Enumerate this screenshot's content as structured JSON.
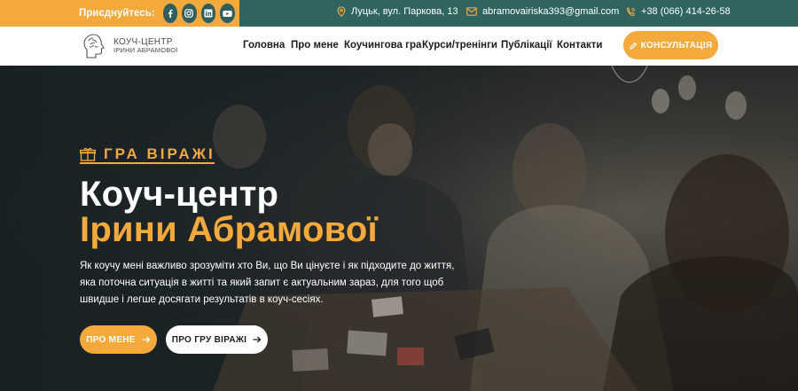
{
  "topbar": {
    "join_label": "Приєднуйтесь:",
    "socials": [
      {
        "icon": "facebook-icon"
      },
      {
        "icon": "instagram-icon"
      },
      {
        "icon": "linkedin-icon"
      },
      {
        "icon": "youtube-icon"
      }
    ],
    "address": "Луцьк, вул. Паркова, 13",
    "email": "abramovairiska393@gmail.com",
    "phone": "+38 (066) 414-26-58"
  },
  "header": {
    "logo_line1": "КОУЧ-ЦЕНТР",
    "logo_line2": "ІРИНИ АБРАМОВОЇ",
    "nav": [
      "Головна",
      "Про мене",
      "Коучингова гра",
      "Курси/тренінги",
      "Публікації",
      "Контакти"
    ],
    "cta_label": "КОНСУЛЬТАЦІЯ"
  },
  "hero": {
    "tag": "ГРА ВІРАЖІ",
    "title_line1": "Коуч-центр",
    "title_line2": "Ірини Абрамової",
    "description": "Як коучу мені важливо зрозуміти хто Ви, що Ви цінуєте і як підходите до життя, яка поточна ситуація в житті та який запит є актуальним зараз, для того щоб швидше і легше досягати результатів в коуч-сесіях.",
    "btn_about": "ПРО МЕНЕ",
    "btn_game": "ПРО ГРУ ВІРАЖІ"
  },
  "colors": {
    "accent": "#f4a93c",
    "topbar_dark": "#2f6460",
    "social_bg": "#2e5f5c"
  }
}
